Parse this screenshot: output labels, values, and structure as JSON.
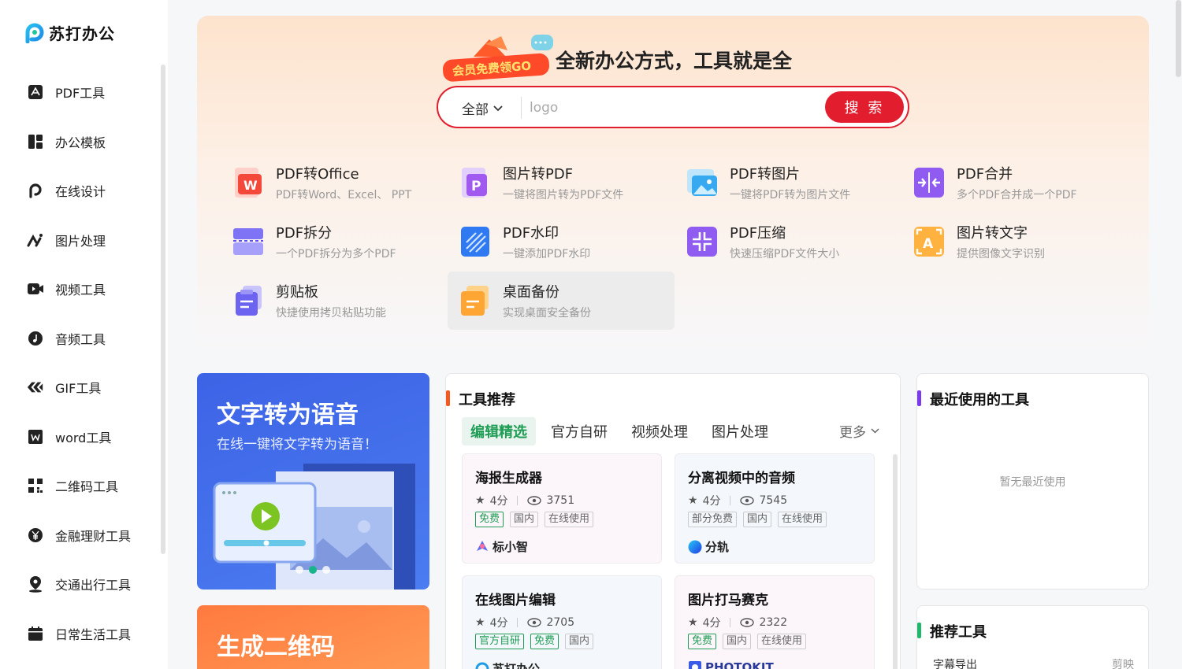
{
  "brand": {
    "name": "苏打办公"
  },
  "sidebar": {
    "items": [
      {
        "label": "PDF工具",
        "icon": "pdf-icon"
      },
      {
        "label": "办公模板",
        "icon": "template-icon"
      },
      {
        "label": "在线设计",
        "icon": "design-icon"
      },
      {
        "label": "图片处理",
        "icon": "image-edit-icon"
      },
      {
        "label": "视频工具",
        "icon": "video-icon"
      },
      {
        "label": "音频工具",
        "icon": "audio-icon"
      },
      {
        "label": "GIF工具",
        "icon": "gif-icon"
      },
      {
        "label": "word工具",
        "icon": "word-icon"
      },
      {
        "label": "二维码工具",
        "icon": "qrcode-icon"
      },
      {
        "label": "金融理财工具",
        "icon": "finance-icon"
      },
      {
        "label": "交通出行工具",
        "icon": "location-icon"
      },
      {
        "label": "日常生活工具",
        "icon": "life-icon"
      }
    ]
  },
  "hero": {
    "promo_text": "会员免费领GO",
    "title": "全新办公方式，工具就是全",
    "search": {
      "scope": "全部",
      "value": "logo",
      "button": "搜 索"
    },
    "tools": [
      {
        "name": "PDF转Office",
        "desc": "PDF转Word、Excel、 PPT"
      },
      {
        "name": "图片转PDF",
        "desc": "一键将图片转为PDF文件"
      },
      {
        "name": "PDF转图片",
        "desc": "一键将PDF转为图片文件"
      },
      {
        "name": "PDF合并",
        "desc": "多个PDF合并成一个PDF"
      },
      {
        "name": "PDF拆分",
        "desc": "一个PDF拆分为多个PDF"
      },
      {
        "name": "PDF水印",
        "desc": "一键添加PDF水印"
      },
      {
        "name": "PDF压缩",
        "desc": "快速压缩PDF文件大小"
      },
      {
        "name": "图片转文字",
        "desc": "提供图像文字识别"
      },
      {
        "name": "剪贴板",
        "desc": "快捷使用拷贝粘贴功能"
      },
      {
        "name": "桌面备份",
        "desc": "实现桌面安全备份"
      }
    ]
  },
  "banners": [
    {
      "title": "文字转为语音",
      "subtitle": "在线一键将文字转为语音！"
    },
    {
      "title": "生成二维码"
    }
  ],
  "recommend": {
    "title": "工具推荐",
    "tabs": [
      "编辑精选",
      "官方自研",
      "视频处理",
      "图片处理"
    ],
    "more": "更多",
    "cards": [
      {
        "name": "海报生成器",
        "score": "4分",
        "views": "3751",
        "tags": [
          "免费",
          "国内",
          "在线使用"
        ],
        "brand": "标小智"
      },
      {
        "name": "分离视频中的音频",
        "score": "4分",
        "views": "7545",
        "tags": [
          "部分免费",
          "国内",
          "在线使用"
        ],
        "brand": "分轨"
      },
      {
        "name": "在线图片编辑",
        "score": "4分",
        "views": "2705",
        "tags": [
          "官方自研",
          "免费",
          "国内"
        ],
        "brand": "苏打办公"
      },
      {
        "name": "图片打马赛克",
        "score": "4分",
        "views": "2322",
        "tags": [
          "免费",
          "国内",
          "在线使用"
        ],
        "brand": "PHOTOKIT"
      }
    ]
  },
  "recent": {
    "title": "最近使用的工具",
    "empty": "暂无最近使用"
  },
  "recommended_tools": {
    "title": "推荐工具",
    "items": [
      {
        "name": "字幕导出",
        "source": "剪映"
      }
    ]
  },
  "colors": {
    "accent_red": "#e11d2e",
    "green": "#1f9d55",
    "orange": "#f25a1f",
    "purple": "#7c3aed"
  }
}
